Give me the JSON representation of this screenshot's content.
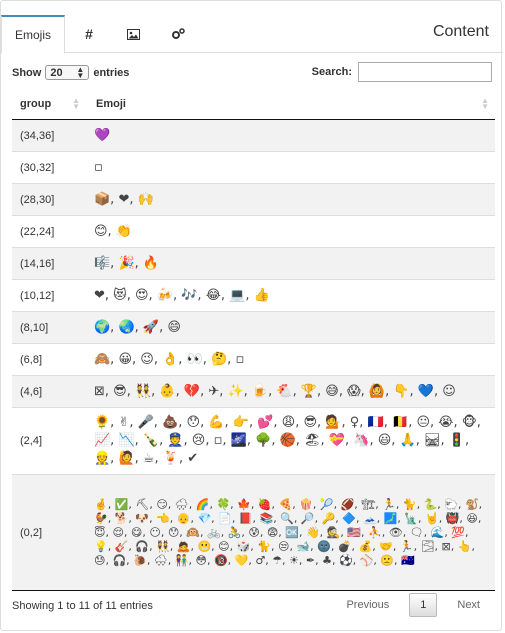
{
  "tabs": [
    {
      "label": "Emojis"
    },
    {
      "label": "#"
    },
    {
      "label": ""
    },
    {
      "label": ""
    }
  ],
  "tabs_title": "Content",
  "controls": {
    "show": "Show",
    "entries_value": "20",
    "entries": "entries",
    "search_label": "Search:"
  },
  "table": {
    "headers": [
      "group",
      "Emoji"
    ],
    "rows": [
      {
        "group": "(34,36]",
        "emoji": "💜"
      },
      {
        "group": "(30,32]",
        "emoji": "▫"
      },
      {
        "group": "(28,30]",
        "emoji": "📦, ❤, 🙌"
      },
      {
        "group": "(22,24]",
        "emoji": "😊, 👏"
      },
      {
        "group": "(14,16]",
        "emoji": "🎼, 🎉, 🔥"
      },
      {
        "group": "(10,12]",
        "emoji": "❤, 😻, 😍, 🍻, 🎶, 😂, 💻, 👍"
      },
      {
        "group": "(8,10]",
        "emoji": "🌍, 🌏, 🚀, 😄"
      },
      {
        "group": "(6,8]",
        "emoji": "🙈, 😀, 😉, 👌, 👀, 🤔, ▫"
      },
      {
        "group": "(4,6]",
        "emoji": "⊠, 😎, 👯, 👶, 💔, ✈, ✨, 🍺, 🐔, 🏆, 😅, 😱, 🙆, 👇, 💙, ☺"
      },
      {
        "group": "(2,4]",
        "emoji": "🌻, ✌, 🎤, 💩, 😯, 💪, 👉, 💕, 😩, 😎, 💁, ♀, 🇫🇷, 🇧🇪, 😐, 😭, 🐵, 📈, 📉, 🍾, 👮, 😢, ▫, 🌌, 🌳, 🏀, 🏖, 💝, 🦄, 😃, 🙏, 🛤, 🚦, 👷, 🙋, ☕, 🍹, ✔"
      },
      {
        "group": "(0,2]",
        "emoji": "🤞, ✅, ⛏, 😏, 🌧, 🌈, 🍀, 🍁, 🍓, 🍕, 🍿, 🎾, 🏈, 🏗, 🏃, 🐈, 🐍, 🐑, 🐒, 🐓, 🐕, 🐶, 👈, 👴, 💎, 📄, 📕, 📚, 🔍, 🔎, 🔑, 🔷, 🗻, 🗾, 🗽, 🤘, 👹, 😆, 😇, 😌, 😋, 😶, 😯, 🙉, 🚲, 🚴, 😰, 😨, 🆗, 👋, 🕵, 🇺🇸, ⛹, 👁, 🗨, 🌊, 💯, 💡, 🎸, 🎧, 👯, 🙇, 😬, 😊, 🎲, 🐈, 😒, 🐋, 🌚, 💣, 💰, 🤝, 🏃, 🌫, ⊠, 👆, 😓, 🎧, 🐌, 🌨, 👫, 😳, 🔞, 💛, ♂, ☂, ☀, ✒, ♣, ⚽, ⚾, 🙁, 🇦🇺"
      }
    ]
  },
  "footer": {
    "info": "Showing 1 to 11 of 11 entries",
    "previous": "Previous",
    "page": "1",
    "next": "Next"
  }
}
